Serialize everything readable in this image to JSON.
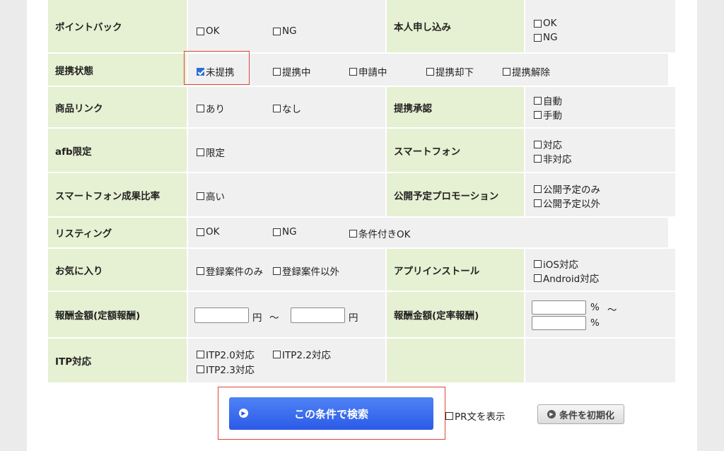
{
  "rows": {
    "point_back": {
      "label": "ポイントバック",
      "ok": "OK",
      "ng": "NG",
      "right_label": "本人申し込み",
      "right_ok": "OK",
      "right_ng": "NG"
    },
    "affiliation": {
      "label": "提携状態",
      "opt1": "未提携",
      "opt2": "提携中",
      "opt3": "申請中",
      "opt4": "提携却下",
      "opt5": "提携解除"
    },
    "product_link": {
      "label": "商品リンク",
      "opt1": "あり",
      "opt2": "なし",
      "right_label": "提携承認",
      "right_opt1": "自動",
      "right_opt2": "手動"
    },
    "afb_limited": {
      "label": "afb限定",
      "opt1": "限定",
      "right_label": "スマートフォン",
      "right_opt1": "対応",
      "right_opt2": "非対応"
    },
    "sp_rate": {
      "label": "スマートフォン成果比率",
      "opt1": "高い",
      "right_label": "公開予定プロモーション",
      "right_opt1": "公開予定のみ",
      "right_opt2": "公開予定以外"
    },
    "listing": {
      "label": "リスティング",
      "opt1": "OK",
      "opt2": "NG",
      "opt3": "条件付きOK"
    },
    "favorites": {
      "label": "お気に入り",
      "opt1": "登録案件のみ",
      "opt2": "登録案件以外",
      "right_label": "アプリインストール",
      "right_opt1": "iOS対応",
      "right_opt2": "Android対応"
    },
    "reward": {
      "label": "報酬金額(定額報酬)",
      "yen1": "円",
      "tilde": "～",
      "yen2": "円",
      "right_label": "報酬金額(定率報酬)",
      "pct1": "%",
      "tilde2": "～",
      "pct2": "%"
    },
    "itp": {
      "label": "ITP対応",
      "opt1": "ITP2.0対応",
      "opt2": "ITP2.2対応",
      "opt3": "ITP2.3対応"
    }
  },
  "footer": {
    "search_label": "この条件で検索",
    "pr_label": "PR文を表示",
    "reset_label": "条件を初期化"
  },
  "colors": {
    "accent": "#2b5ae8",
    "label_bg": "#e6f0d2",
    "highlight": "#e0453a"
  }
}
